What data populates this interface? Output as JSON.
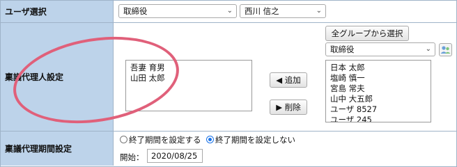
{
  "user_select": {
    "label": "ユーザ選択",
    "role_value": "取締役",
    "user_value": "西川 信之"
  },
  "proxy_setting": {
    "label": "稟議代理人設定",
    "selected_users": [
      "吾妻 育男",
      "山田 太郎"
    ],
    "add_label": "◀ 追加",
    "remove_label": "▶ 削除",
    "all_groups_button": "全グループから選択",
    "group_value": "取締役",
    "candidates": [
      "日本 太郎",
      "塩崎 慎一",
      "宮島 常夫",
      "山中 大五郎",
      "ユーザ 8527",
      "ユーザ 245"
    ]
  },
  "period_setting": {
    "label": "稟議代理期間設定",
    "option_set": "終了期間を設定する",
    "option_none": "終了期間を設定しない",
    "selected": "none",
    "start_label": "開始：",
    "start_value": "2020/08/25"
  },
  "colors": {
    "label_bg": "#bdd3ea",
    "highlight": "#e0607a"
  }
}
